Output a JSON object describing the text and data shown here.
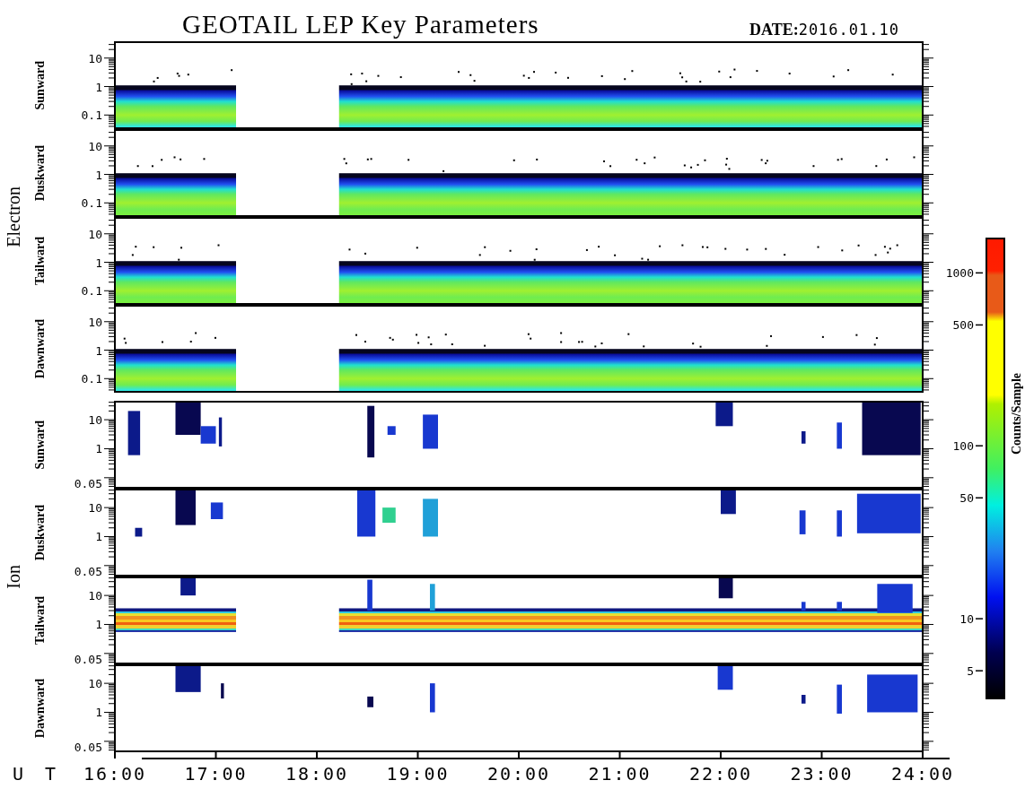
{
  "title": "GEOTAIL LEP Key Parameters",
  "date": {
    "label": "DATE:",
    "value": "2016.01.10"
  },
  "groups": [
    {
      "kind": "electron",
      "label": "Electron",
      "panels": [
        {
          "label": "Sunward",
          "yticks": [
            "10",
            "1",
            "0.1"
          ]
        },
        {
          "label": "Duskward",
          "yticks": [
            "10",
            "1",
            "0.1"
          ]
        },
        {
          "label": "Tailward",
          "yticks": [
            "10",
            "1",
            "0.1"
          ]
        },
        {
          "label": "Dawnward",
          "yticks": [
            "10",
            "1",
            "0.1"
          ]
        }
      ]
    },
    {
      "kind": "ion",
      "label": "Ion",
      "panels": [
        {
          "label": "Sunward",
          "yticks": [
            "10",
            "1",
            "0.05"
          ]
        },
        {
          "label": "Duskward",
          "yticks": [
            "10",
            "1",
            "0.05"
          ]
        },
        {
          "label": "Tailward",
          "yticks": [
            "10",
            "1",
            "0.05"
          ]
        },
        {
          "label": "Dawnward",
          "yticks": [
            "10",
            "1",
            "0.05"
          ]
        }
      ]
    }
  ],
  "x_axis": {
    "label": "U T",
    "ticks": [
      "16:00",
      "17:00",
      "18:00",
      "19:00",
      "20:00",
      "21:00",
      "22:00",
      "23:00",
      "24:00"
    ]
  },
  "colorbar": {
    "title": "Counts/Sample",
    "ticks": [
      "1000",
      "500",
      "100",
      "50",
      "10",
      "5"
    ]
  }
}
